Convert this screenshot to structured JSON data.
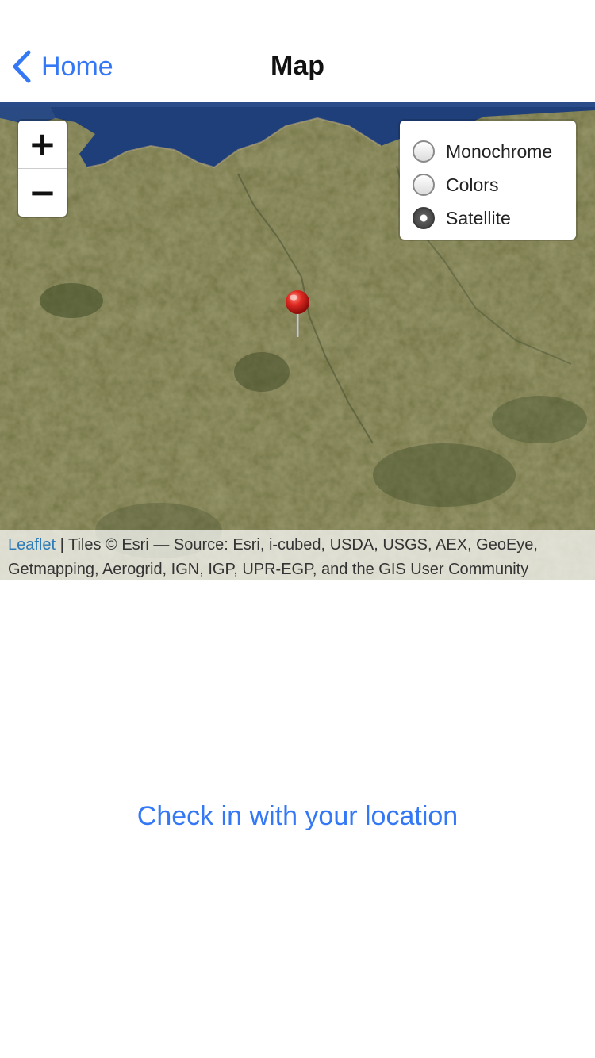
{
  "nav": {
    "back_label": "Home",
    "title": "Map"
  },
  "map": {
    "zoom_in_label": "+",
    "zoom_out_label": "−",
    "layers": [
      {
        "label": "Monochrome",
        "checked": false
      },
      {
        "label": "Colors",
        "checked": false
      },
      {
        "label": "Satellite",
        "checked": true
      }
    ],
    "attribution": {
      "link_label": "Leaflet",
      "text": " | Tiles © Esri — Source: Esri, i-cubed, USDA, USGS, AEX, GeoEye, Getmapping, Aerogrid, IGN, IGP, UPR-EGP, and the GIS User Community"
    }
  },
  "checkin_label": "Check in with your location",
  "colors": {
    "accent": "#3478f6",
    "link": "#2a7ab8",
    "pin": "#d9231f"
  }
}
